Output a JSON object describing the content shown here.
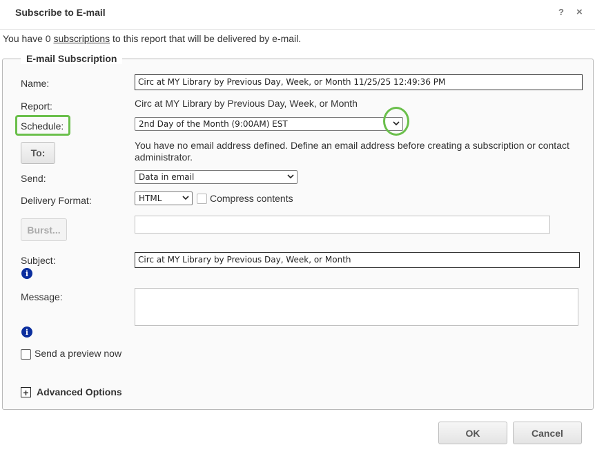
{
  "dialog": {
    "title": "Subscribe to E-mail",
    "help_label": "?",
    "close_label": "×"
  },
  "intro": {
    "prefix": "You have 0 ",
    "link": "subscriptions",
    "suffix": " to this report that will be delivered by e-mail."
  },
  "section": {
    "legend": "E-mail Subscription"
  },
  "form": {
    "name_label": "Name:",
    "name_value": "Circ at MY Library by Previous Day, Week, or Month 11/25/25 12:49:36 PM",
    "report_label": "Report:",
    "report_value": "Circ at MY Library by Previous Day, Week, or Month",
    "schedule_label": "Schedule:",
    "schedule_value": "2nd Day of the Month (9:00AM) EST",
    "to_button": "To:",
    "no_email_message": "You have no email address defined. Define an email address before creating a subscription or contact administrator.",
    "send_label": "Send:",
    "send_value": "Data in email",
    "delivery_label": "Delivery Format:",
    "delivery_value": "HTML",
    "compress_label": "Compress contents",
    "burst_button": "Burst...",
    "burst_value": "",
    "subject_label": "Subject:",
    "subject_value": "Circ at MY Library by Previous Day, Week, or Month",
    "message_label": "Message:",
    "message_value": "",
    "preview_label": "Send a preview now",
    "advanced_label": "Advanced Options",
    "info_icon_glyph": "i",
    "plus_glyph": "+"
  },
  "footer": {
    "ok_label": "OK",
    "cancel_label": "Cancel"
  },
  "colors": {
    "highlight": "#6abf4b",
    "info_icon": "#0b2e9e"
  }
}
